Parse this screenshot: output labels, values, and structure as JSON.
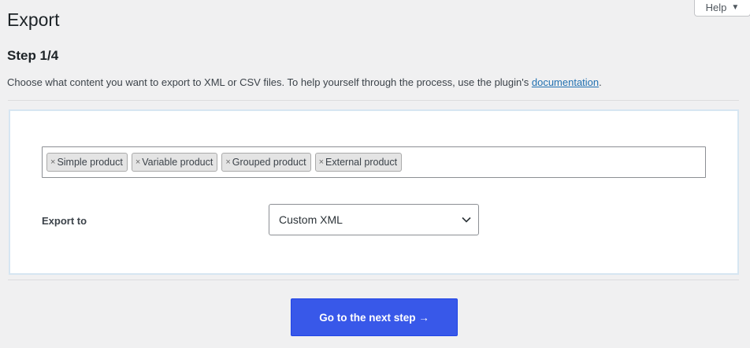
{
  "help": {
    "label": "Help",
    "caret": "▼"
  },
  "page": {
    "title": "Export"
  },
  "step": {
    "title": "Step 1/4"
  },
  "intro": {
    "text": "Choose what content you want to export to XML or CSV files. To help yourself through the process, use the plugin's ",
    "link": "documentation",
    "suffix": "."
  },
  "tags": [
    {
      "remove": "×",
      "label": "Simple product"
    },
    {
      "remove": "×",
      "label": "Variable product"
    },
    {
      "remove": "×",
      "label": "Grouped product"
    },
    {
      "remove": "×",
      "label": "External product"
    }
  ],
  "export_to": {
    "label": "Export to",
    "selected": "Custom XML"
  },
  "next": {
    "label": "Go to the next step →"
  },
  "colors": {
    "primary_button": "#3858e9",
    "link": "#2271b1",
    "background": "#f0f0f1"
  }
}
